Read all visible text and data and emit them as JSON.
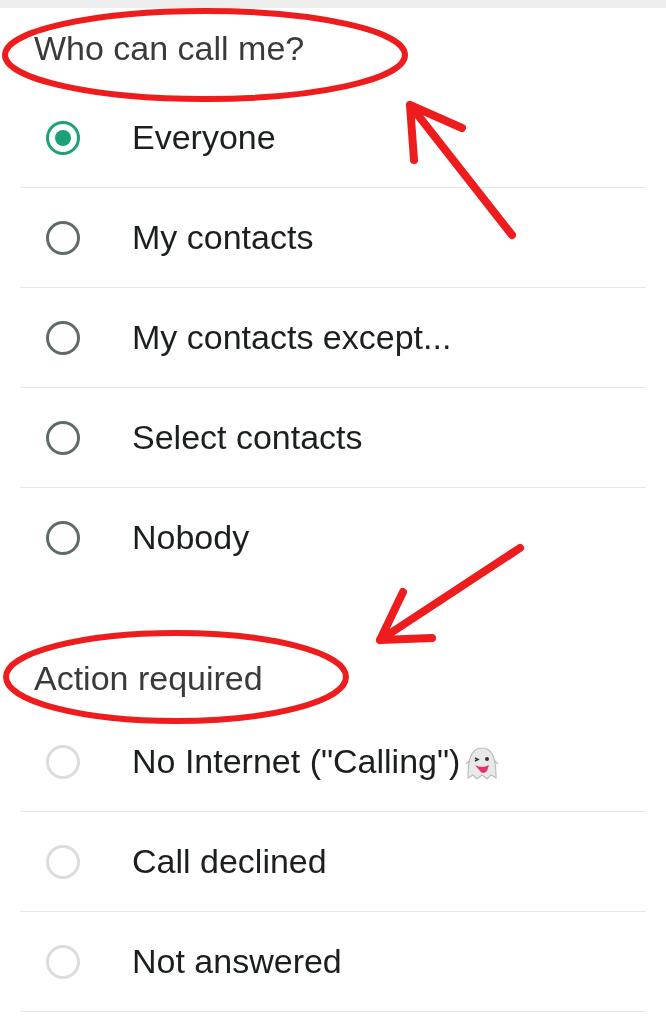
{
  "sections": [
    {
      "title": "Who can call me?",
      "circled": true,
      "pointed_at": true,
      "options": [
        {
          "label": "Everyone",
          "selected": true,
          "disabled": false
        },
        {
          "label": "My contacts",
          "selected": false,
          "disabled": false
        },
        {
          "label": "My contacts except...",
          "selected": false,
          "disabled": false
        },
        {
          "label": "Select contacts",
          "selected": false,
          "disabled": false
        },
        {
          "label": "Nobody",
          "selected": false,
          "disabled": false
        }
      ]
    },
    {
      "title": "Action required",
      "circled": true,
      "pointed_at": true,
      "options": [
        {
          "label": "No Internet (\"Calling\")",
          "selected": false,
          "disabled": true,
          "kind": "with-emoji"
        },
        {
          "label": "Call declined",
          "selected": false,
          "disabled": true
        },
        {
          "label": "Not answered",
          "selected": false,
          "disabled": true
        }
      ]
    }
  ]
}
